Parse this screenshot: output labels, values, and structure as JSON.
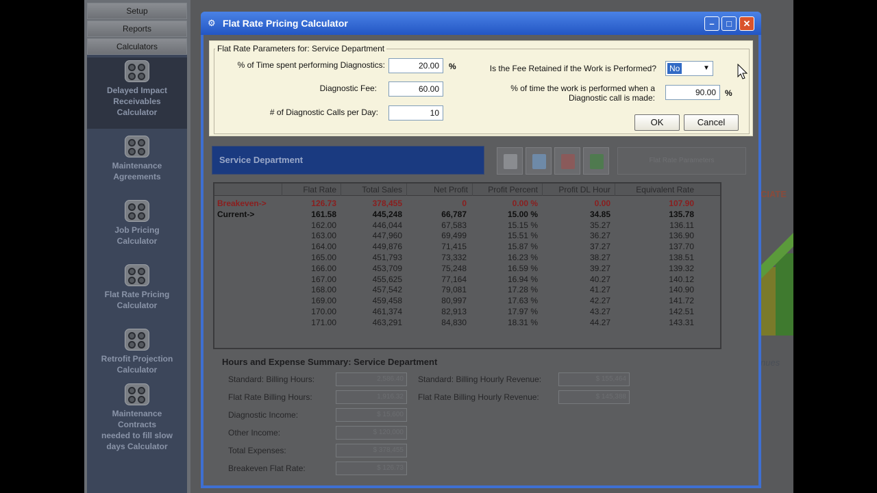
{
  "sidebar": {
    "nav": [
      "Setup",
      "Reports",
      "Calculators"
    ],
    "calculators": [
      {
        "label": "Delayed Impact Receivables Calculator",
        "lines": [
          "Delayed Impact",
          "Receivables",
          "Calculator"
        ]
      },
      {
        "label": "Maintenance Agreements",
        "lines": [
          "Maintenance",
          "Agreements"
        ]
      },
      {
        "label": "Job Pricing Calculator",
        "lines": [
          "Job Pricing",
          "Calculator"
        ]
      },
      {
        "label": "Flat Rate Pricing Calculator",
        "lines": [
          "Flat Rate Pricing",
          "Calculator"
        ]
      },
      {
        "label": "Retrofit Projection Calculator",
        "lines": [
          "Retrofit Projection",
          "Calculator"
        ]
      },
      {
        "label": "Maintenance Contracts needed to fill slow days Calculator",
        "lines": [
          "Maintenance",
          "Contracts",
          "needed to fill slow",
          "days Calculator"
        ]
      }
    ]
  },
  "background": {
    "partial_text_1": "CIATE",
    "partial_text_2": "nues"
  },
  "dialog": {
    "title": "Flat Rate Pricing Calculator",
    "params": {
      "legend": "Flat Rate Parameters for: Service Department",
      "time_diag_label": "% of Time spent performing Diagnostics:",
      "time_diag_value": "20.00",
      "diag_fee_label": "Diagnostic Fee:",
      "diag_fee_value": "60.00",
      "diag_calls_label": "# of Diagnostic Calls per Day:",
      "diag_calls_value": "10",
      "fee_retained_label": "Is the Fee Retained if the Work is Performed?",
      "fee_retained_value": "No",
      "work_performed_label_1": "% of time the work is performed when a",
      "work_performed_label_2": "Diagnostic call is made:",
      "work_performed_value": "90.00",
      "percent_sign": "%",
      "ok_label": "OK",
      "cancel_label": "Cancel"
    },
    "department_title": "Service Department",
    "tools": [
      "printer-icon",
      "preview-icon",
      "pdf-icon",
      "excel-icon"
    ],
    "tool_wide_label": "Flat Rate Parameters",
    "table": {
      "headers": [
        "",
        "Flat Rate",
        "Total Sales",
        "Net Profit",
        "Profit Percent",
        "Profit DL Hour",
        "Equivalent Rate"
      ],
      "rows": [
        {
          "kind": "breakeven",
          "cells": [
            "Breakeven->",
            "126.73",
            "378,455",
            "0",
            "0.00 %",
            "0.00",
            "107.90"
          ]
        },
        {
          "kind": "current",
          "cells": [
            "Current->",
            "161.58",
            "445,248",
            "66,787",
            "15.00 %",
            "34.85",
            "135.78"
          ]
        },
        {
          "kind": "normal",
          "cells": [
            "",
            "162.00",
            "446,044",
            "67,583",
            "15.15 %",
            "35.27",
            "136.11"
          ]
        },
        {
          "kind": "normal",
          "cells": [
            "",
            "163.00",
            "447,960",
            "69,499",
            "15.51 %",
            "36.27",
            "136.90"
          ]
        },
        {
          "kind": "normal",
          "cells": [
            "",
            "164.00",
            "449,876",
            "71,415",
            "15.87 %",
            "37.27",
            "137.70"
          ]
        },
        {
          "kind": "normal",
          "cells": [
            "",
            "165.00",
            "451,793",
            "73,332",
            "16.23 %",
            "38.27",
            "138.51"
          ]
        },
        {
          "kind": "normal",
          "cells": [
            "",
            "166.00",
            "453,709",
            "75,248",
            "16.59 %",
            "39.27",
            "139.32"
          ]
        },
        {
          "kind": "normal",
          "cells": [
            "",
            "167.00",
            "455,625",
            "77,164",
            "16.94 %",
            "40.27",
            "140.12"
          ]
        },
        {
          "kind": "normal",
          "cells": [
            "",
            "168.00",
            "457,542",
            "79,081",
            "17.28 %",
            "41.27",
            "140.90"
          ]
        },
        {
          "kind": "normal",
          "cells": [
            "",
            "169.00",
            "459,458",
            "80,997",
            "17.63 %",
            "42.27",
            "141.72"
          ]
        },
        {
          "kind": "normal",
          "cells": [
            "",
            "170.00",
            "461,374",
            "82,913",
            "17.97 %",
            "43.27",
            "142.51"
          ]
        },
        {
          "kind": "normal",
          "cells": [
            "",
            "171.00",
            "463,291",
            "84,830",
            "18.31 %",
            "44.27",
            "143.31"
          ]
        }
      ]
    },
    "summary": {
      "title": "Hours and Expense Summary: Service Department",
      "left": [
        {
          "label": "Standard: Billing Hours:",
          "value": "2,586.40"
        },
        {
          "label": "Flat Rate Billing Hours:",
          "value": "1,916.32"
        },
        {
          "label": "Diagnostic Income:",
          "value": "$ 15,600"
        },
        {
          "label": "Other Income:",
          "value": "$ 120,000"
        },
        {
          "label": "Total Expenses:",
          "value": "$ 378,455"
        },
        {
          "label": "Breakeven Flat Rate:",
          "value": "$ 126.73"
        }
      ],
      "right": [
        {
          "label": "Standard: Billing Hourly Revenue:",
          "value": "$ 155,464"
        },
        {
          "label": "Flat Rate Billing Hourly Revenue:",
          "value": "$ 145,388"
        }
      ]
    }
  },
  "colors": {
    "title_bar": "#2356c4",
    "params_bg": "#f6f3dd",
    "breakeven_text": "#8a1e1e",
    "close_button": "#d9532c"
  }
}
